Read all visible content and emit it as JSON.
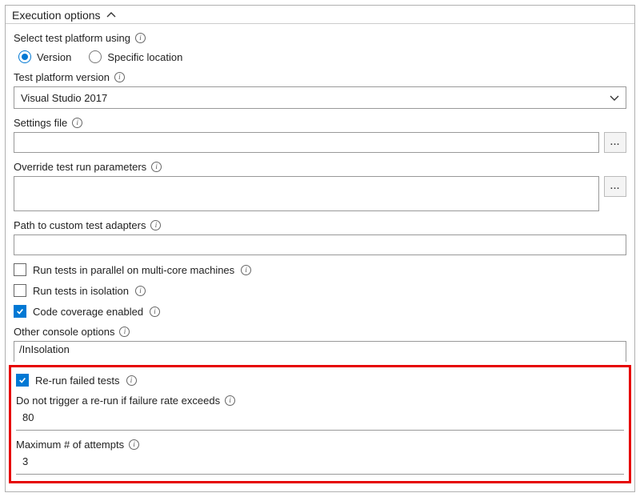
{
  "header": {
    "title": "Execution options"
  },
  "platformSelector": {
    "label": "Select test platform using",
    "options": {
      "version": "Version",
      "specific": "Specific location"
    },
    "selected": "version"
  },
  "platformVersion": {
    "label": "Test platform version",
    "value": "Visual Studio 2017"
  },
  "settingsFile": {
    "label": "Settings file",
    "value": "",
    "more": "..."
  },
  "overrideParams": {
    "label": "Override test run parameters",
    "value": "",
    "more": "..."
  },
  "customAdapters": {
    "label": "Path to custom test adapters",
    "value": ""
  },
  "parallel": {
    "label": "Run tests in parallel on multi-core machines",
    "checked": false
  },
  "isolation": {
    "label": "Run tests in isolation",
    "checked": false
  },
  "coverage": {
    "label": "Code coverage enabled",
    "checked": true
  },
  "consoleOptions": {
    "label": "Other console options",
    "value": "/InIsolation"
  },
  "rerun": {
    "label": "Re-run failed tests",
    "checked": true
  },
  "failureRate": {
    "label": "Do not trigger a re-run if failure rate exceeds",
    "value": "80"
  },
  "maxAttempts": {
    "label": "Maximum # of attempts",
    "value": "3"
  }
}
